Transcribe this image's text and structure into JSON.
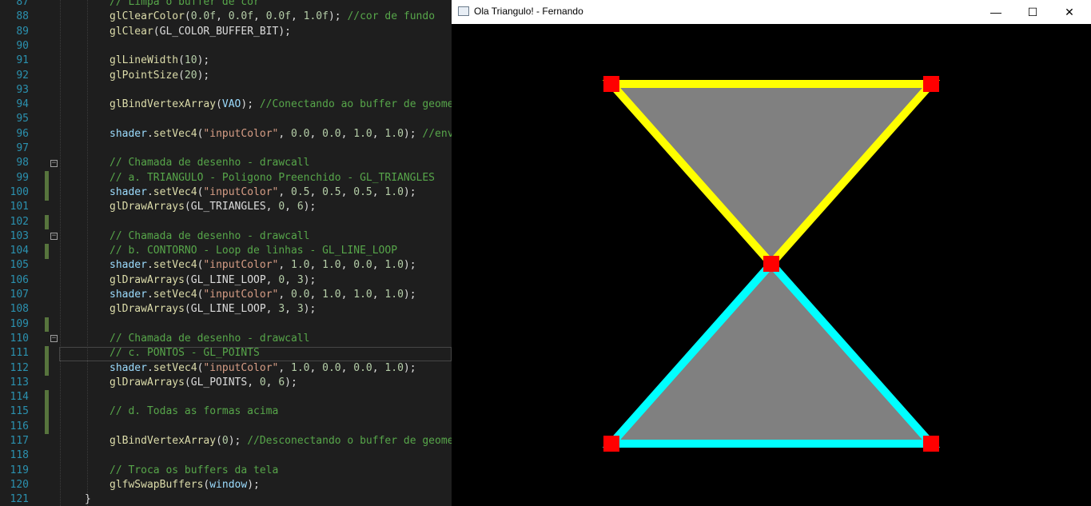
{
  "editor": {
    "lines": [
      {
        "n": "87",
        "tokens": [
          {
            "t": "// Limpa o buffer de cor",
            "c": "cm"
          }
        ]
      },
      {
        "n": "88",
        "tokens": [
          {
            "t": "glClearColor",
            "c": "fn"
          },
          {
            "t": "("
          },
          {
            "t": "0.0f",
            "c": "num"
          },
          {
            "t": ", "
          },
          {
            "t": "0.0f",
            "c": "num"
          },
          {
            "t": ", "
          },
          {
            "t": "0.0f",
            "c": "num"
          },
          {
            "t": ", "
          },
          {
            "t": "1.0f",
            "c": "num"
          },
          {
            "t": "); "
          },
          {
            "t": "//cor de fundo",
            "c": "cm"
          }
        ]
      },
      {
        "n": "89",
        "tokens": [
          {
            "t": "glClear",
            "c": "fn"
          },
          {
            "t": "(GL_COLOR_BUFFER_BIT);"
          }
        ]
      },
      {
        "n": "90",
        "tokens": []
      },
      {
        "n": "91",
        "tokens": [
          {
            "t": "glLineWidth",
            "c": "fn"
          },
          {
            "t": "("
          },
          {
            "t": "10",
            "c": "num"
          },
          {
            "t": ");"
          }
        ]
      },
      {
        "n": "92",
        "tokens": [
          {
            "t": "glPointSize",
            "c": "fn"
          },
          {
            "t": "("
          },
          {
            "t": "20",
            "c": "num"
          },
          {
            "t": ");"
          }
        ]
      },
      {
        "n": "93",
        "tokens": []
      },
      {
        "n": "94",
        "tokens": [
          {
            "t": "glBindVertexArray",
            "c": "fn"
          },
          {
            "t": "("
          },
          {
            "t": "VAO",
            "c": "var"
          },
          {
            "t": "); "
          },
          {
            "t": "//Conectando ao buffer de geomet",
            "c": "cm"
          }
        ]
      },
      {
        "n": "95",
        "tokens": []
      },
      {
        "n": "96",
        "tokens": [
          {
            "t": "shader",
            "c": "var"
          },
          {
            "t": "."
          },
          {
            "t": "setVec4",
            "c": "fn"
          },
          {
            "t": "("
          },
          {
            "t": "\"inputColor\"",
            "c": "str"
          },
          {
            "t": ", "
          },
          {
            "t": "0.0",
            "c": "num"
          },
          {
            "t": ", "
          },
          {
            "t": "0.0",
            "c": "num"
          },
          {
            "t": ", "
          },
          {
            "t": "1.0",
            "c": "num"
          },
          {
            "t": ", "
          },
          {
            "t": "1.0",
            "c": "num"
          },
          {
            "t": "); "
          },
          {
            "t": "//envi",
            "c": "cm"
          }
        ]
      },
      {
        "n": "97",
        "tokens": []
      },
      {
        "n": "98",
        "tokens": [
          {
            "t": "// Chamada de desenho - drawcall",
            "c": "cm"
          }
        ]
      },
      {
        "n": "99",
        "tokens": [
          {
            "t": "// a. TRIANGULO - Poligono Preenchido - GL_TRIANGLES",
            "c": "cm"
          }
        ]
      },
      {
        "n": "100",
        "tokens": [
          {
            "t": "shader",
            "c": "var"
          },
          {
            "t": "."
          },
          {
            "t": "setVec4",
            "c": "fn"
          },
          {
            "t": "("
          },
          {
            "t": "\"inputColor\"",
            "c": "str"
          },
          {
            "t": ", "
          },
          {
            "t": "0.5",
            "c": "num"
          },
          {
            "t": ", "
          },
          {
            "t": "0.5",
            "c": "num"
          },
          {
            "t": ", "
          },
          {
            "t": "0.5",
            "c": "num"
          },
          {
            "t": ", "
          },
          {
            "t": "1.0",
            "c": "num"
          },
          {
            "t": ");"
          }
        ]
      },
      {
        "n": "101",
        "tokens": [
          {
            "t": "glDrawArrays",
            "c": "fn"
          },
          {
            "t": "(GL_TRIANGLES, "
          },
          {
            "t": "0",
            "c": "num"
          },
          {
            "t": ", "
          },
          {
            "t": "6",
            "c": "num"
          },
          {
            "t": ");"
          }
        ]
      },
      {
        "n": "102",
        "tokens": []
      },
      {
        "n": "103",
        "tokens": [
          {
            "t": "// Chamada de desenho - drawcall",
            "c": "cm"
          }
        ]
      },
      {
        "n": "104",
        "tokens": [
          {
            "t": "// b. CONTORNO - Loop de linhas - GL_LINE_LOOP",
            "c": "cm"
          }
        ]
      },
      {
        "n": "105",
        "tokens": [
          {
            "t": "shader",
            "c": "var"
          },
          {
            "t": "."
          },
          {
            "t": "setVec4",
            "c": "fn"
          },
          {
            "t": "("
          },
          {
            "t": "\"inputColor\"",
            "c": "str"
          },
          {
            "t": ", "
          },
          {
            "t": "1.0",
            "c": "num"
          },
          {
            "t": ", "
          },
          {
            "t": "1.0",
            "c": "num"
          },
          {
            "t": ", "
          },
          {
            "t": "0.0",
            "c": "num"
          },
          {
            "t": ", "
          },
          {
            "t": "1.0",
            "c": "num"
          },
          {
            "t": ");"
          }
        ]
      },
      {
        "n": "106",
        "tokens": [
          {
            "t": "glDrawArrays",
            "c": "fn"
          },
          {
            "t": "(GL_LINE_LOOP, "
          },
          {
            "t": "0",
            "c": "num"
          },
          {
            "t": ", "
          },
          {
            "t": "3",
            "c": "num"
          },
          {
            "t": ");"
          }
        ]
      },
      {
        "n": "107",
        "tokens": [
          {
            "t": "shader",
            "c": "var"
          },
          {
            "t": "."
          },
          {
            "t": "setVec4",
            "c": "fn"
          },
          {
            "t": "("
          },
          {
            "t": "\"inputColor\"",
            "c": "str"
          },
          {
            "t": ", "
          },
          {
            "t": "0.0",
            "c": "num"
          },
          {
            "t": ", "
          },
          {
            "t": "1.0",
            "c": "num"
          },
          {
            "t": ", "
          },
          {
            "t": "1.0",
            "c": "num"
          },
          {
            "t": ", "
          },
          {
            "t": "1.0",
            "c": "num"
          },
          {
            "t": ");"
          }
        ]
      },
      {
        "n": "108",
        "tokens": [
          {
            "t": "glDrawArrays",
            "c": "fn"
          },
          {
            "t": "(GL_LINE_LOOP, "
          },
          {
            "t": "3",
            "c": "num"
          },
          {
            "t": ", "
          },
          {
            "t": "3",
            "c": "num"
          },
          {
            "t": ");"
          }
        ]
      },
      {
        "n": "109",
        "tokens": []
      },
      {
        "n": "110",
        "tokens": [
          {
            "t": "// Chamada de desenho - drawcall",
            "c": "cm"
          }
        ]
      },
      {
        "n": "111",
        "tokens": [
          {
            "t": "// c. PONTOS - GL_POINTS",
            "c": "cm"
          }
        ]
      },
      {
        "n": "112",
        "tokens": [
          {
            "t": "shader",
            "c": "var"
          },
          {
            "t": "."
          },
          {
            "t": "setVec4",
            "c": "fn"
          },
          {
            "t": "("
          },
          {
            "t": "\"inputColor\"",
            "c": "str"
          },
          {
            "t": ", "
          },
          {
            "t": "1.0",
            "c": "num"
          },
          {
            "t": ", "
          },
          {
            "t": "0.0",
            "c": "num"
          },
          {
            "t": ", "
          },
          {
            "t": "0.0",
            "c": "num"
          },
          {
            "t": ", "
          },
          {
            "t": "1.0",
            "c": "num"
          },
          {
            "t": ");"
          }
        ]
      },
      {
        "n": "113",
        "tokens": [
          {
            "t": "glDrawArrays",
            "c": "fn"
          },
          {
            "t": "(GL_POINTS, "
          },
          {
            "t": "0",
            "c": "num"
          },
          {
            "t": ", "
          },
          {
            "t": "6",
            "c": "num"
          },
          {
            "t": ");"
          }
        ]
      },
      {
        "n": "114",
        "tokens": []
      },
      {
        "n": "115",
        "tokens": [
          {
            "t": "// d. Todas as formas acima",
            "c": "cm"
          }
        ]
      },
      {
        "n": "116",
        "tokens": []
      },
      {
        "n": "117",
        "tokens": [
          {
            "t": "glBindVertexArray",
            "c": "fn"
          },
          {
            "t": "("
          },
          {
            "t": "0",
            "c": "num"
          },
          {
            "t": "); "
          },
          {
            "t": "//Desconectando o buffer de geomet",
            "c": "cm"
          }
        ]
      },
      {
        "n": "118",
        "tokens": []
      },
      {
        "n": "119",
        "tokens": [
          {
            "t": "// Troca os buffers da tela",
            "c": "cm"
          }
        ]
      },
      {
        "n": "120",
        "tokens": [
          {
            "t": "glfwSwapBuffers",
            "c": "fn"
          },
          {
            "t": "("
          },
          {
            "t": "window",
            "c": "var"
          },
          {
            "t": ");"
          }
        ]
      },
      {
        "n": "121",
        "tokens": [
          {
            "t": "}"
          }
        ]
      }
    ],
    "fold_markers": [
      "98",
      "103",
      "110"
    ],
    "changed_lines": [
      "99",
      "100",
      "102",
      "104",
      "109",
      "111",
      "112",
      "114",
      "115",
      "116"
    ],
    "current_line": "111"
  },
  "gl_window": {
    "title": "Ola Triangulo! - Fernando",
    "minimize_glyph": "—",
    "maximize_glyph": "☐",
    "close_glyph": "✕",
    "render": {
      "background": "#000000",
      "fill_color": "#808080",
      "outline_top_color": "#ffff00",
      "outline_bottom_color": "#00ffff",
      "point_color": "#ff0000",
      "triangles": [
        [
          [
            -0.5,
            0.75
          ],
          [
            0.5,
            0.75
          ],
          [
            0.0,
            0.0
          ]
        ],
        [
          [
            -0.5,
            -0.75
          ],
          [
            0.5,
            -0.75
          ],
          [
            0.0,
            0.0
          ]
        ]
      ]
    }
  }
}
